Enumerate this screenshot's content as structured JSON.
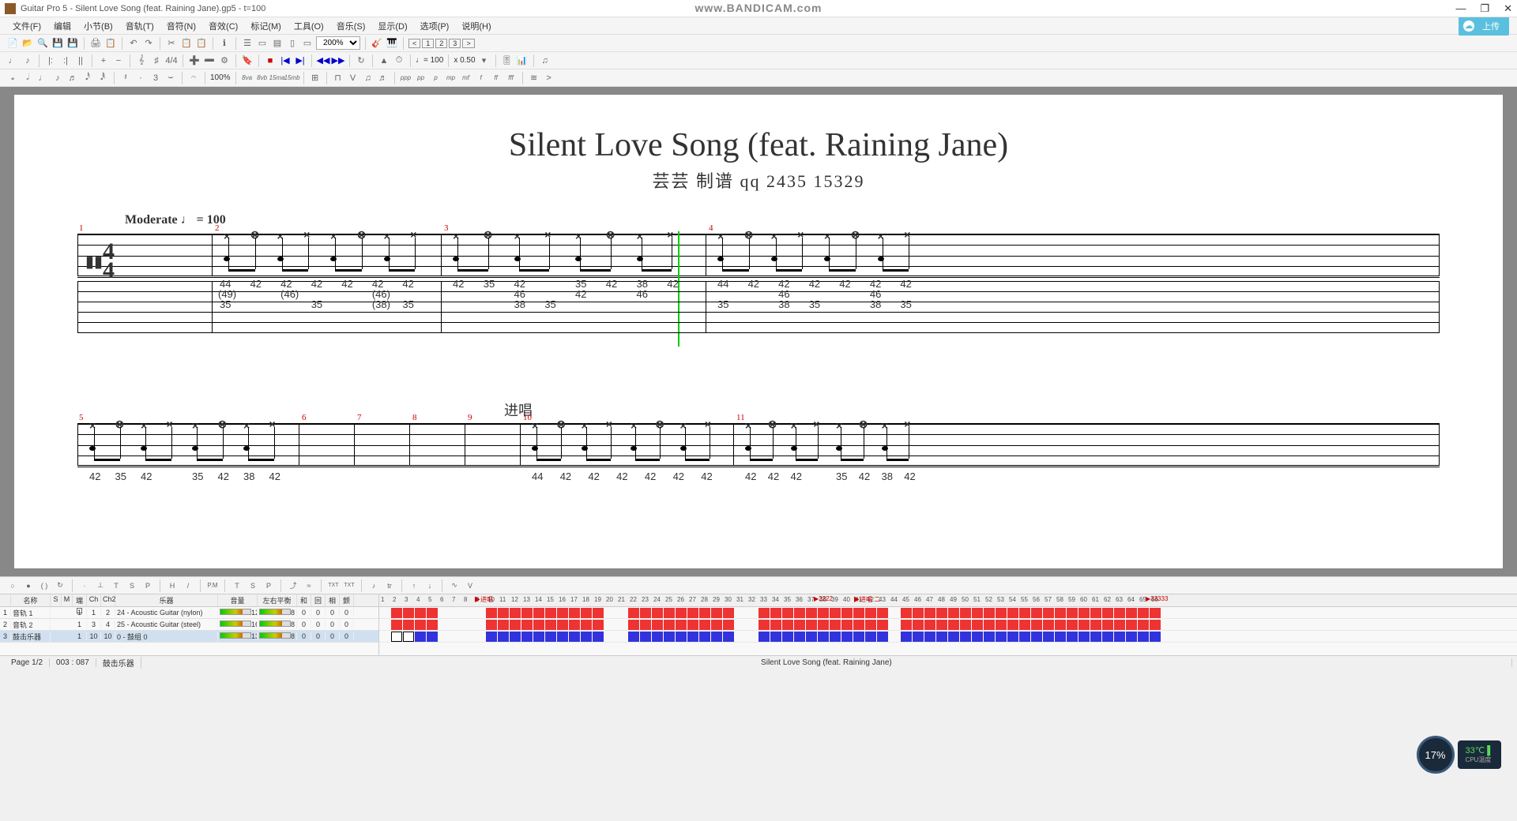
{
  "window": {
    "title": "Guitar Pro 5 - Silent Love Song (feat. Raining Jane).gp5 - t=100",
    "watermark": "www.BANDICAM.com"
  },
  "menu": {
    "items": [
      "文件(F)",
      "编辑",
      "小节(B)",
      "音轨(T)",
      "音符(N)",
      "音效(C)",
      "标记(M)",
      "工具(O)",
      "音乐(S)",
      "显示(D)",
      "选项(P)",
      "说明(H)"
    ],
    "upload": "上传"
  },
  "toolbar1": {
    "zoom": "200%",
    "pages": [
      "1",
      "2",
      "3"
    ]
  },
  "toolbar2": {
    "tempo": "100",
    "speed": "x 0.50"
  },
  "toolbar3": {
    "percent": "100%"
  },
  "score": {
    "title": "Silent Love Song (feat. Raining Jane)",
    "subtitle": "芸芸 制谱     qq  2435 15329",
    "tempo_label": "Moderate   ♩ = 100",
    "section2": "进唱",
    "measures1": [
      "1",
      "2",
      "3",
      "4"
    ],
    "measures2": [
      "5",
      "6",
      "7",
      "8",
      "9",
      "10",
      "11"
    ],
    "tab_row1": {
      "m1": [
        "44",
        "42",
        "42",
        "42",
        "42",
        "42",
        "42"
      ],
      "m1_ghost": "(49)",
      "m1_s2": [
        "",
        "",
        "(46)",
        "",
        "",
        "(46)",
        ""
      ],
      "m1_s3": [
        "35",
        "",
        "",
        "35",
        "",
        "(38)",
        "35"
      ],
      "m2": [
        "42",
        "35",
        "42",
        "",
        "35",
        "42",
        "38",
        "42"
      ],
      "m2_s2": [
        "",
        "",
        "46",
        "",
        "42",
        "",
        "46",
        ""
      ],
      "m2_s3": [
        "",
        "",
        "38",
        "35",
        "",
        "",
        "",
        ""
      ],
      "m3": [
        "44",
        "42",
        "42",
        "42",
        "42",
        "42",
        "42"
      ],
      "m3_s2": [
        "",
        "",
        "46",
        "",
        "",
        "46",
        ""
      ],
      "m3_s3": [
        "35",
        "",
        "38",
        "35",
        "",
        "38",
        "35"
      ]
    },
    "tab_row2": {
      "m5": [
        "42",
        "35",
        "42",
        "",
        "35",
        "42",
        "38",
        "42"
      ],
      "m10": [
        "44",
        "42",
        "42",
        "42",
        "42",
        "42",
        "42"
      ],
      "m11": [
        "42",
        "42",
        "42",
        "",
        "35",
        "42",
        "38",
        "42"
      ]
    }
  },
  "tracks": {
    "headers": [
      "",
      "名称",
      "S",
      "M",
      "端口",
      "Ch",
      "Ch2",
      "乐器",
      "音量",
      "左右平衡",
      "和",
      "回",
      "相",
      "颤"
    ],
    "rows": [
      {
        "num": "1",
        "name": "音轨 1",
        "port": "1",
        "ch": "1",
        "ch2": "2",
        "instr": "24 - Acoustic Guitar (nylon)",
        "vol": "12",
        "pan": "8",
        "h": "0",
        "r": "0",
        "p": "0",
        "c": "0"
      },
      {
        "num": "2",
        "name": "音轨 2",
        "port": "1",
        "ch": "3",
        "ch2": "4",
        "instr": "25 - Acoustic Guitar (steel)",
        "vol": "16",
        "pan": "8",
        "h": "0",
        "r": "0",
        "p": "0",
        "c": "0"
      },
      {
        "num": "3",
        "name": "鼓击乐器",
        "port": "1",
        "ch": "10",
        "ch2": "10",
        "instr": "0 - 鼓组 0",
        "vol": "13",
        "pan": "8",
        "h": "0",
        "r": "0",
        "p": "0",
        "c": "0"
      }
    ]
  },
  "timeline": {
    "markers": [
      {
        "pos": 120,
        "text": "▶进唱"
      },
      {
        "pos": 550,
        "text": "▶2222"
      },
      {
        "pos": 600,
        "text": "▶进唱 二"
      },
      {
        "pos": 970,
        "text": "▶33333"
      }
    ],
    "ticks": [
      "1",
      "2",
      "3",
      "4",
      "5",
      "6",
      "7",
      "8",
      "9",
      "10",
      "11",
      "12",
      "13",
      "14",
      "15",
      "16",
      "17",
      "18",
      "19",
      "20",
      "21",
      "22",
      "23",
      "24",
      "25",
      "26",
      "27",
      "28",
      "29",
      "30",
      "31",
      "32",
      "33",
      "34",
      "35",
      "36",
      "37",
      "38",
      "39",
      "40",
      "41",
      "42",
      "43",
      "44",
      "45",
      "46",
      "47",
      "48",
      "49",
      "50",
      "51",
      "52",
      "53",
      "54",
      "55",
      "56",
      "57",
      "58",
      "59",
      "60",
      "61",
      "62",
      "63",
      "64",
      "65",
      "66"
    ]
  },
  "status": {
    "page": "Page 1/2",
    "pos": "003 : 087",
    "track": "鼓击乐器",
    "song": "Silent Love Song (feat. Raining Jane)"
  },
  "hw": {
    "cpu_pct": "17%",
    "temp": "33℃",
    "temp_label": "CPU温度"
  }
}
